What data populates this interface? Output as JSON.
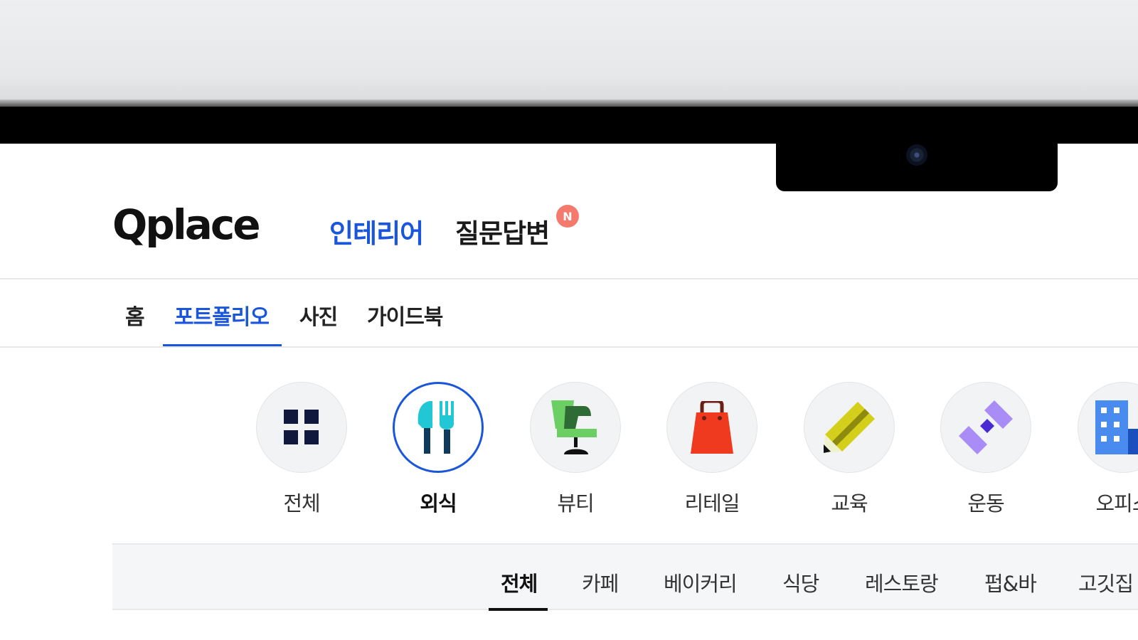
{
  "header": {
    "logo": "Qplace",
    "nav": [
      {
        "label": "인테리어",
        "active": true
      },
      {
        "label": "질문답변",
        "badge": "N"
      }
    ]
  },
  "subtabs": [
    {
      "label": "홈"
    },
    {
      "label": "포트폴리오",
      "active": true
    },
    {
      "label": "사진"
    },
    {
      "label": "가이드북"
    }
  ],
  "categories": [
    {
      "label": "전체",
      "icon": "grid-icon"
    },
    {
      "label": "외식",
      "icon": "fork-knife-icon",
      "active": true
    },
    {
      "label": "뷰티",
      "icon": "salon-chair-icon"
    },
    {
      "label": "리테일",
      "icon": "shopping-bag-icon"
    },
    {
      "label": "교육",
      "icon": "pencil-icon"
    },
    {
      "label": "운동",
      "icon": "dumbbell-icon"
    },
    {
      "label": "오피스",
      "icon": "office-building-icon"
    }
  ],
  "filters": [
    {
      "label": "전체",
      "active": true
    },
    {
      "label": "카페"
    },
    {
      "label": "베이커리"
    },
    {
      "label": "식당"
    },
    {
      "label": "레스토랑"
    },
    {
      "label": "펍&바"
    },
    {
      "label": "고깃집"
    }
  ],
  "colors": {
    "accent": "#1a56db",
    "badge": "#f47a6e",
    "utensils": "#22c7d6",
    "chair": "#5fbf5a",
    "bag": "#f03a1f",
    "pencil": "#d4cf1a",
    "dumbbell": "#8d6ff0",
    "office": "#4a8bf0"
  }
}
